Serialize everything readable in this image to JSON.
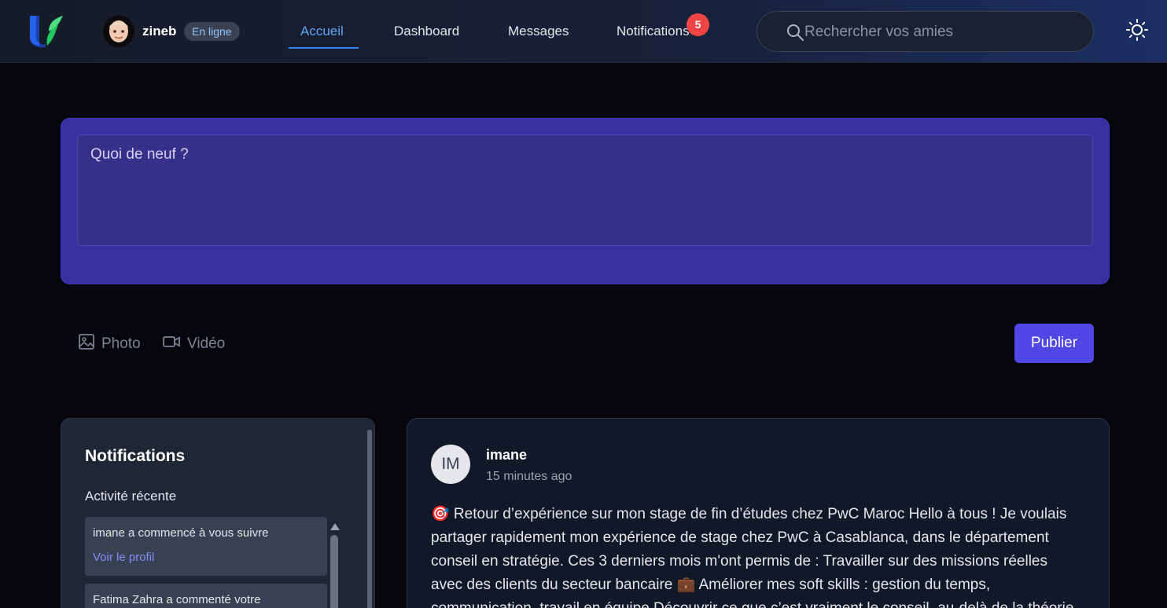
{
  "header": {
    "user": {
      "name": "zineb",
      "status": "En ligne"
    },
    "nav": [
      {
        "label": "Accueil",
        "active": true
      },
      {
        "label": "Dashboard",
        "active": false
      },
      {
        "label": "Messages",
        "active": false
      },
      {
        "label": "Notifications",
        "active": false
      }
    ],
    "notifications_count": "5",
    "search": {
      "placeholder": "Rechercher vos amies"
    },
    "icons": {
      "logo": "shield-leaf-logo",
      "search": "search-icon",
      "theme": "sun-icon"
    }
  },
  "composer": {
    "placeholder": "Quoi de neuf ?",
    "photo_label": "Photo",
    "video_label": "Vidéo",
    "publish_label": "Publier"
  },
  "notifications_panel": {
    "title": "Notifications",
    "subtitle": "Activité récente",
    "items": [
      {
        "text": "imane a commencé à vous suivre",
        "link": "Voir le profil"
      },
      {
        "text": "Fatima Zahra a commenté votre"
      }
    ]
  },
  "post": {
    "avatar_initials": "IM",
    "author": "imane",
    "time": "15 minutes ago",
    "body": "🎯 Retour d’expérience sur mon stage de fin d’études chez PwC Maroc Hello à tous ! Je voulais partager rapidement mon expérience de stage chez PwC à Casablanca, dans le département conseil en stratégie. Ces 3 derniers mois m'ont permis de : Travailler sur des missions réelles avec des clients du secteur bancaire 💼 Améliorer mes soft skills : gestion du temps, communication, travail en équipe Découvrir ce que c’est vraiment le conseil, au-delà de la théorie"
  },
  "colors": {
    "accent": "#3b82f6",
    "composer_bg": "#3730a3",
    "publish": "#4f46e5",
    "badge": "#ef4444",
    "link": "#818cf8"
  }
}
